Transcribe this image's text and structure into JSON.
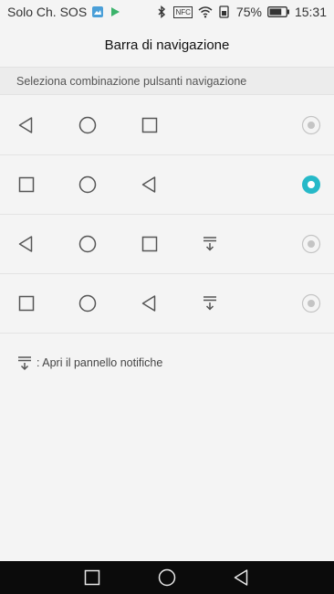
{
  "status_bar": {
    "carrier": "Solo Ch. SOS",
    "nfc": "NFC",
    "battery": "75%",
    "time": "15:31"
  },
  "header": {
    "title": "Barra di navigazione"
  },
  "section": {
    "label": "Seleziona combinazione pulsanti navigazione"
  },
  "options": [
    {
      "buttons": [
        "back",
        "home",
        "recent"
      ],
      "selected": false
    },
    {
      "buttons": [
        "recent",
        "home",
        "back"
      ],
      "selected": true
    },
    {
      "buttons": [
        "back",
        "home",
        "recent",
        "notification"
      ],
      "selected": false
    },
    {
      "buttons": [
        "recent",
        "home",
        "back",
        "notification"
      ],
      "selected": false
    }
  ],
  "legend": {
    "text": ": Apri il pannello notifiche",
    "icon": "notification-pull-icon"
  },
  "system_nav": {
    "buttons": [
      "recent",
      "home",
      "back"
    ]
  },
  "colors": {
    "accent": "#26b9c8",
    "icon": "#555555",
    "background": "#f4f4f4",
    "navbar": "#0b0b0b"
  }
}
